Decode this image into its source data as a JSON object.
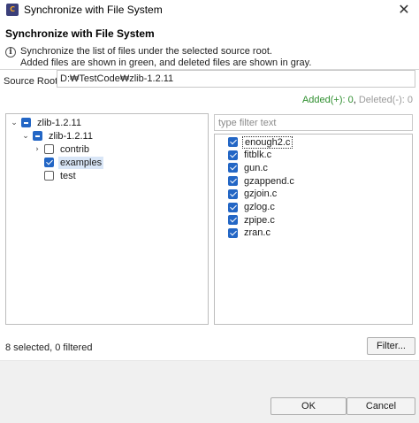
{
  "window": {
    "title": "Synchronize with File System",
    "icon": "app-logo-icon",
    "close_glyph": "✕"
  },
  "header": {
    "title": "Synchronize with File System",
    "description_line1": "Synchronize the list of files under the selected source root.",
    "description_line2": "Added files are shown in green, and deleted files are shown in gray."
  },
  "source_root": {
    "label": "Source Root:",
    "value": "D:₩TestCode₩zlib-1.2.11"
  },
  "counts": {
    "added": "Added(+): 0",
    "separator": ", ",
    "deleted": "Deleted(-): 0"
  },
  "tree": [
    {
      "label": "zlib-1.2.11",
      "depth": 0,
      "expander": "⌄",
      "state": "partial",
      "selected": false
    },
    {
      "label": "zlib-1.2.11",
      "depth": 1,
      "expander": "⌄",
      "state": "partial",
      "selected": false
    },
    {
      "label": "contrib",
      "depth": 2,
      "expander": "›",
      "state": "unchecked",
      "selected": false
    },
    {
      "label": "examples",
      "depth": 2,
      "expander": "",
      "state": "checked",
      "selected": true
    },
    {
      "label": "test",
      "depth": 2,
      "expander": "",
      "state": "unchecked",
      "selected": false
    }
  ],
  "filter": {
    "placeholder": "type filter text",
    "value": ""
  },
  "files": [
    {
      "label": "enough2.c",
      "checked": true,
      "focused": true
    },
    {
      "label": "fitblk.c",
      "checked": true,
      "focused": false
    },
    {
      "label": "gun.c",
      "checked": true,
      "focused": false
    },
    {
      "label": "gzappend.c",
      "checked": true,
      "focused": false
    },
    {
      "label": "gzjoin.c",
      "checked": true,
      "focused": false
    },
    {
      "label": "gzlog.c",
      "checked": true,
      "focused": false
    },
    {
      "label": "zpipe.c",
      "checked": true,
      "focused": false
    },
    {
      "label": "zran.c",
      "checked": true,
      "focused": false
    }
  ],
  "status": {
    "text": "8 selected, 0 filtered"
  },
  "buttons": {
    "filter": "Filter...",
    "ok": "OK",
    "cancel": "Cancel"
  },
  "colors": {
    "added": "#2f8f2f",
    "deleted": "#9a9a9a",
    "checkbox": "#2366c5",
    "selection": "#d9e6f7"
  }
}
